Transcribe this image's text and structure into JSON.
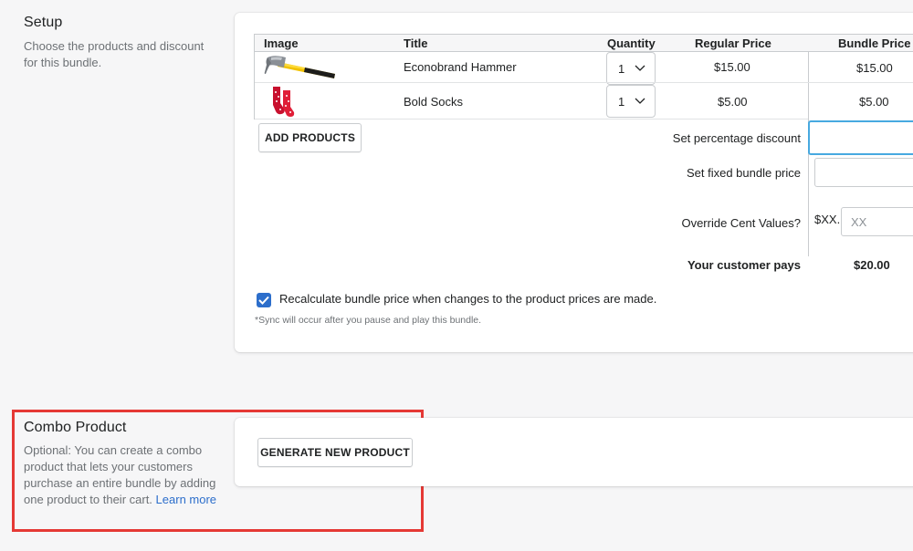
{
  "setup": {
    "title": "Setup",
    "description": "Choose the products and discount for this bundle."
  },
  "table": {
    "headers": {
      "image": "Image",
      "title": "Title",
      "quantity": "Quantity",
      "regular_price": "Regular Price",
      "bundle_price": "Bundle Price"
    },
    "rows": [
      {
        "title": "Econobrand Hammer",
        "quantity": "1",
        "regular_price": "$15.00",
        "bundle_price": "$15.00",
        "image_icon": "hammer-icon"
      },
      {
        "title": "Bold Socks",
        "quantity": "1",
        "regular_price": "$5.00",
        "bundle_price": "$5.00",
        "image_icon": "socks-icon"
      }
    ]
  },
  "actions": {
    "add_products": "ADD PRODUCTS"
  },
  "discount": {
    "percentage_label": "Set percentage discount",
    "percentage_value": "",
    "fixed_label": "Set fixed bundle price",
    "fixed_value": "",
    "override_label": "Override Cent Values?",
    "override_prefix": "$XX.",
    "override_placeholder": "XX",
    "override_value": "",
    "customer_pays_label": "Your customer pays",
    "customer_pays_value": "$20.00"
  },
  "recalc": {
    "checked": true,
    "label": "Recalculate bundle price when changes to the product prices are made.",
    "note": "*Sync will occur after you pause and play this bundle."
  },
  "combo": {
    "title": "Combo Product",
    "description": "Optional: You can create a combo product that lets your customers purchase an entire bundle by adding one product to their cart.",
    "learn_more": "Learn more",
    "generate_button": "GENERATE NEW PRODUCT"
  },
  "colors": {
    "accent": "#2c6ecb",
    "focus": "#47a9e0",
    "highlight": "#e53935"
  }
}
